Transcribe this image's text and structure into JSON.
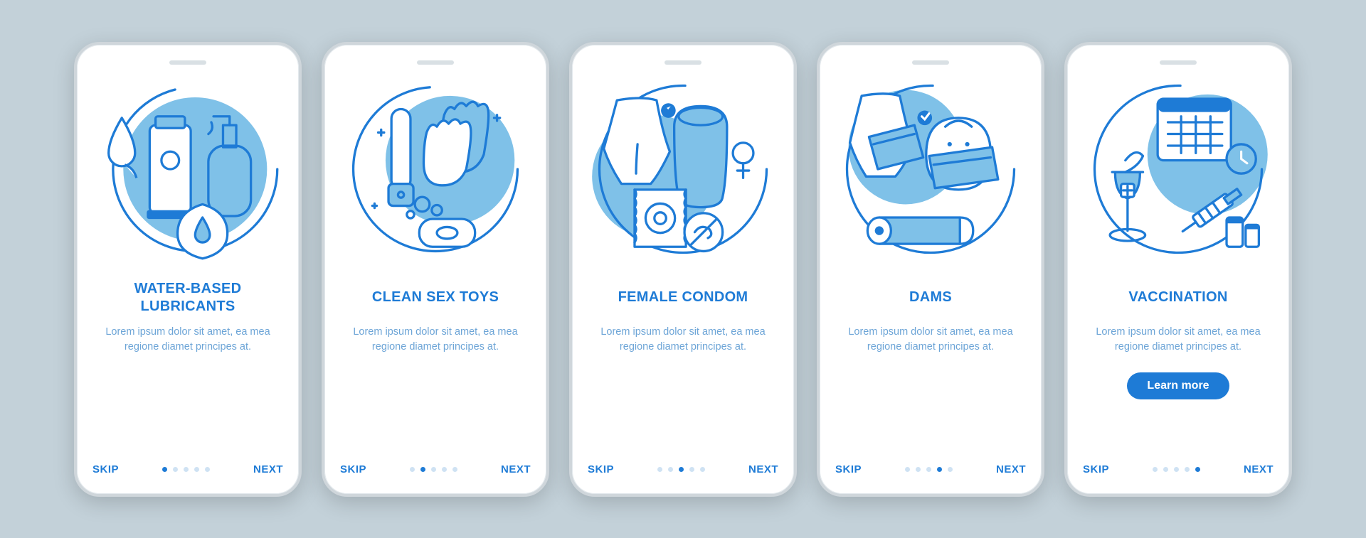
{
  "common": {
    "skip_label": "SKIP",
    "next_label": "NEXT",
    "description": "Lorem ipsum dolor sit amet, ea mea regione diamet principes at.",
    "accent_color": "#1e7bd6",
    "light_blue": "#7fc1e8",
    "background": "#c3d1d9",
    "total_steps": 5
  },
  "screens": [
    {
      "title": "Water-based lubricants",
      "icon_name": "lubricant-icon",
      "active_step": 1,
      "has_cta": false
    },
    {
      "title": "Clean sex toys",
      "icon_name": "clean-toys-icon",
      "active_step": 2,
      "has_cta": false
    },
    {
      "title": "Female condom",
      "icon_name": "female-condom-icon",
      "active_step": 3,
      "has_cta": false
    },
    {
      "title": "Dams",
      "icon_name": "dams-icon",
      "active_step": 4,
      "has_cta": false
    },
    {
      "title": "Vaccination",
      "icon_name": "vaccination-icon",
      "active_step": 5,
      "has_cta": true,
      "cta_label": "Learn more"
    }
  ]
}
